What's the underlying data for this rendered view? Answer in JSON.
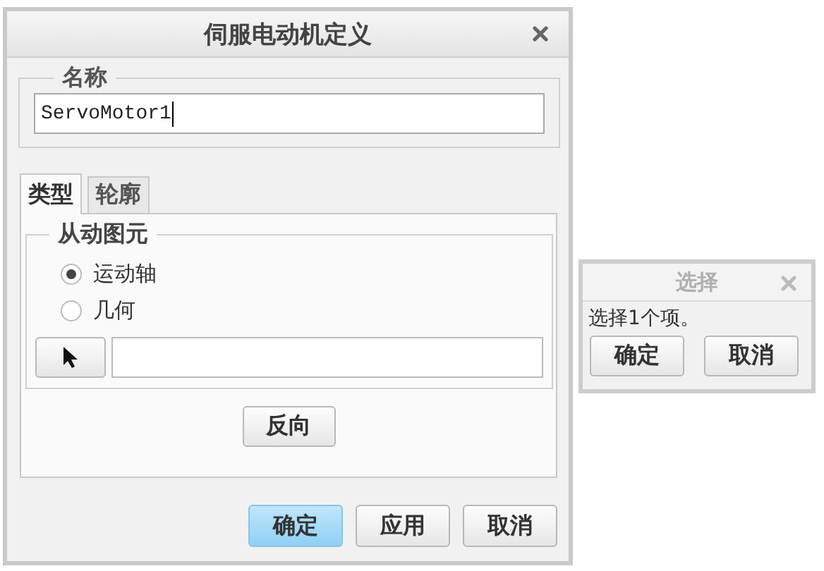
{
  "main_dialog": {
    "title": "伺服电动机定义",
    "name_group": {
      "label": "名称",
      "value": "ServoMotor1"
    },
    "tabs": [
      {
        "label": "类型",
        "selected": true
      },
      {
        "label": "轮廓",
        "selected": false
      }
    ],
    "driven_entity": {
      "label": "从动图元",
      "options": [
        {
          "label": "运动轴",
          "selected": true
        },
        {
          "label": "几何",
          "selected": false
        }
      ]
    },
    "reverse_button": "反向",
    "buttons": [
      {
        "label": "确定",
        "kind": "primary"
      },
      {
        "label": "应用",
        "kind": "normal"
      },
      {
        "label": "取消",
        "kind": "normal"
      }
    ]
  },
  "select_dialog": {
    "title": "选择",
    "active": false,
    "message": "选择1个项。",
    "buttons": [
      "确定",
      "取消"
    ]
  }
}
